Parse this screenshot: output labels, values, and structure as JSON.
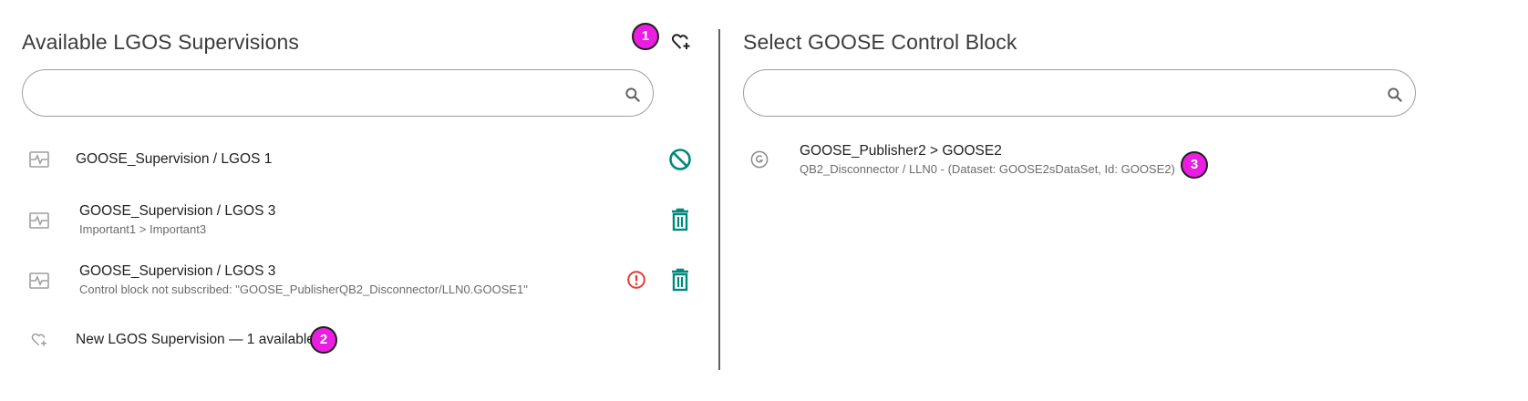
{
  "left_panel": {
    "title": "Available LGOS Supervisions",
    "search": {
      "value": "",
      "placeholder": ""
    },
    "add_icon": "heart-plus-icon",
    "items": [
      {
        "primary": "GOOSE_Supervision / LGOS 1",
        "secondary": "",
        "icon": "supervision-icon",
        "action_icon": "block-icon"
      },
      {
        "primary": "GOOSE_Supervision / LGOS 3",
        "secondary": "Important1 > Important3",
        "icon": "supervision-icon",
        "action_icon": "delete-icon"
      },
      {
        "primary": "GOOSE_Supervision / LGOS 3",
        "secondary": "Control block not subscribed: \"GOOSE_PublisherQB2_Disconnector/LLN0.GOOSE1\"",
        "icon": "supervision-icon",
        "warning_icon": "error-icon",
        "action_icon": "delete-icon"
      }
    ],
    "new_item": {
      "label": "New LGOS Supervision — 1 available",
      "icon": "heart-plus-icon"
    }
  },
  "right_panel": {
    "title": "Select GOOSE Control Block",
    "search": {
      "value": "",
      "placeholder": ""
    },
    "items": [
      {
        "primary": "GOOSE_Publisher2 > GOOSE2",
        "secondary": "QB2_Disconnector / LLN0 - (Dataset: GOOSE2sDataSet, Id: GOOSE2)",
        "icon": "goose-g-icon"
      }
    ]
  },
  "badges": [
    "1",
    "2",
    "3"
  ],
  "colors": {
    "teal": "#00897b",
    "warning": "#e53935",
    "badge": "#e91ee0",
    "icon_gray": "#757575"
  }
}
